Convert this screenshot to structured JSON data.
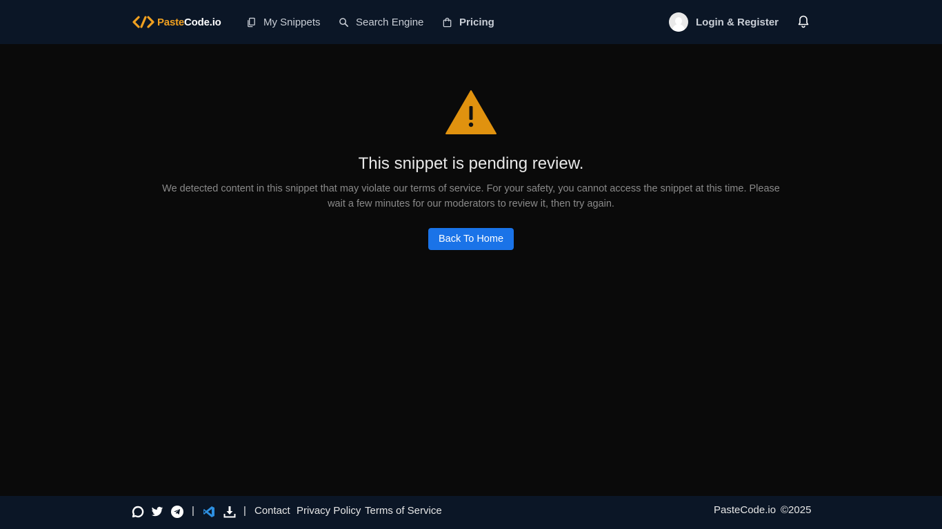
{
  "header": {
    "logo_part1": "Paste",
    "logo_part2": "Code.io",
    "nav": {
      "my_snippets": "My Snippets",
      "search_engine": "Search Engine",
      "pricing": "Pricing"
    },
    "login": "Login & Register"
  },
  "main": {
    "title": "This snippet is pending review.",
    "description": "We detected content in this snippet that may violate our terms of service. For your safety, you cannot access the snippet at this time. Please wait a few minutes for our moderators to review it, then try again.",
    "button": "Back To Home"
  },
  "footer": {
    "separator": "|",
    "links": {
      "contact": "Contact",
      "privacy": "Privacy Policy",
      "terms": "Terms of Service"
    },
    "brand": "PasteCode.io",
    "copyright": "©2025"
  },
  "colors": {
    "header_bg": "#0b1626",
    "page_bg": "#0a0a0a",
    "accent": "#f0a020",
    "warning": "#e0920f",
    "button": "#1a73e8"
  }
}
